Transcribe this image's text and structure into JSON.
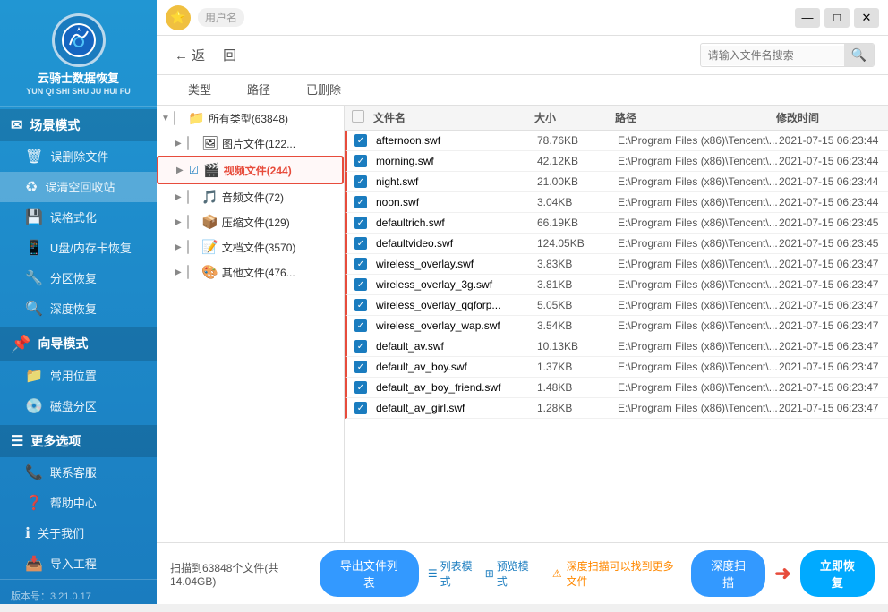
{
  "app": {
    "title": "云骑士数据恢复",
    "subtitle": "YUN QI SHI SHU JU HUI FU",
    "version": "版本号：3.21.0.17"
  },
  "sidebar": {
    "scene_mode_label": "场景模式",
    "items_scene": [
      {
        "id": "wrong-delete",
        "label": "误删除文件",
        "icon": "🗑"
      },
      {
        "id": "recycle-bin",
        "label": "误清空回收站",
        "icon": "♻",
        "active": true
      },
      {
        "id": "wrong-format",
        "label": "误格式化",
        "icon": "💾"
      },
      {
        "id": "usb-recover",
        "label": "U盘/内存卡恢复",
        "icon": "📱"
      },
      {
        "id": "partition",
        "label": "分区恢复",
        "icon": "🔧"
      },
      {
        "id": "deep-recover",
        "label": "深度恢复",
        "icon": "🔍"
      }
    ],
    "guide_mode_label": "向导模式",
    "items_guide": [
      {
        "id": "common-location",
        "label": "常用位置",
        "icon": "📁"
      },
      {
        "id": "disk-partition",
        "label": "磁盘分区",
        "icon": "💿"
      }
    ],
    "more_label": "更多选项",
    "items_more": [
      {
        "id": "contact",
        "label": "联系客服",
        "icon": "📞"
      },
      {
        "id": "help",
        "label": "帮助中心",
        "icon": "❓"
      },
      {
        "id": "about",
        "label": "关于我们",
        "icon": "ℹ"
      },
      {
        "id": "import",
        "label": "导入工程",
        "icon": "📥"
      }
    ]
  },
  "toolbar": {
    "back_label": "← 返",
    "forward_label": "回",
    "search_placeholder": "请输入文件名搜索"
  },
  "filter_tabs": [
    {
      "id": "type",
      "label": "类型",
      "active": false
    },
    {
      "id": "path",
      "label": "路径",
      "active": false
    },
    {
      "id": "deleted",
      "label": "已删除",
      "active": false
    }
  ],
  "file_header": {
    "check": "",
    "name": "文件名",
    "size": "大小",
    "path": "路径",
    "time": "修改时间"
  },
  "tree_items": [
    {
      "id": "all-types",
      "label": "所有类型(63848)",
      "icon": "📁",
      "level": 0,
      "expanded": true,
      "checked": false,
      "color": "#f0a030"
    },
    {
      "id": "image-files",
      "label": "图片文件(122...",
      "icon": "🖼",
      "level": 1,
      "expanded": false,
      "checked": false
    },
    {
      "id": "video-files",
      "label": "视频文件(244)",
      "icon": "🎬",
      "level": 1,
      "expanded": false,
      "checked": false,
      "highlighted": true
    },
    {
      "id": "audio-files",
      "label": "音频文件(72)",
      "icon": "🎵",
      "level": 1,
      "expanded": false,
      "checked": false
    },
    {
      "id": "compressed-files",
      "label": "压缩文件(129)",
      "icon": "📦",
      "level": 1,
      "expanded": false,
      "checked": false
    },
    {
      "id": "doc-files",
      "label": "文档文件(3570)",
      "icon": "📝",
      "level": 1,
      "expanded": false,
      "checked": false
    },
    {
      "id": "other-files",
      "label": "其他文件(476...",
      "icon": "🎨",
      "level": 1,
      "expanded": false,
      "checked": false
    }
  ],
  "files": [
    {
      "id": 1,
      "checked": true,
      "name": "afternoon.swf",
      "size": "78.76KB",
      "path": "E:\\Program Files (x86)\\Tencent\\...",
      "time": "2021-07-15 06:23:44",
      "highlighted": true
    },
    {
      "id": 2,
      "checked": true,
      "name": "morning.swf",
      "size": "42.12KB",
      "path": "E:\\Program Files (x86)\\Tencent\\...",
      "time": "2021-07-15 06:23:44",
      "highlighted": true
    },
    {
      "id": 3,
      "checked": true,
      "name": "night.swf",
      "size": "21.00KB",
      "path": "E:\\Program Files (x86)\\Tencent\\...",
      "time": "2021-07-15 06:23:44",
      "highlighted": true
    },
    {
      "id": 4,
      "checked": true,
      "name": "noon.swf",
      "size": "3.04KB",
      "path": "E:\\Program Files (x86)\\Tencent\\...",
      "time": "2021-07-15 06:23:44",
      "highlighted": true
    },
    {
      "id": 5,
      "checked": true,
      "name": "defaultrich.swf",
      "size": "66.19KB",
      "path": "E:\\Program Files (x86)\\Tencent\\...",
      "time": "2021-07-15 06:23:45",
      "highlighted": true
    },
    {
      "id": 6,
      "checked": true,
      "name": "defaultvideo.swf",
      "size": "124.05KB",
      "path": "E:\\Program Files (x86)\\Tencent\\...",
      "time": "2021-07-15 06:23:45",
      "highlighted": true
    },
    {
      "id": 7,
      "checked": true,
      "name": "wireless_overlay.swf",
      "size": "3.83KB",
      "path": "E:\\Program Files (x86)\\Tencent\\...",
      "time": "2021-07-15 06:23:47",
      "highlighted": true
    },
    {
      "id": 8,
      "checked": true,
      "name": "wireless_overlay_3g.swf",
      "size": "3.81KB",
      "path": "E:\\Program Files (x86)\\Tencent\\...",
      "time": "2021-07-15 06:23:47",
      "highlighted": true
    },
    {
      "id": 9,
      "checked": true,
      "name": "wireless_overlay_qqforp...",
      "size": "5.05KB",
      "path": "E:\\Program Files (x86)\\Tencent\\...",
      "time": "2021-07-15 06:23:47",
      "highlighted": true
    },
    {
      "id": 10,
      "checked": true,
      "name": "wireless_overlay_wap.swf",
      "size": "3.54KB",
      "path": "E:\\Program Files (x86)\\Tencent\\...",
      "time": "2021-07-15 06:23:47",
      "highlighted": true
    },
    {
      "id": 11,
      "checked": true,
      "name": "default_av.swf",
      "size": "10.13KB",
      "path": "E:\\Program Files (x86)\\Tencent\\...",
      "time": "2021-07-15 06:23:47",
      "highlighted": true
    },
    {
      "id": 12,
      "checked": true,
      "name": "default_av_boy.swf",
      "size": "1.37KB",
      "path": "E:\\Program Files (x86)\\Tencent\\...",
      "time": "2021-07-15 06:23:47",
      "highlighted": true
    },
    {
      "id": 13,
      "checked": true,
      "name": "default_av_boy_friend.swf",
      "size": "1.48KB",
      "path": "E:\\Program Files (x86)\\Tencent\\...",
      "time": "2021-07-15 06:23:47",
      "highlighted": true
    },
    {
      "id": 14,
      "checked": true,
      "name": "default_av_girl.swf",
      "size": "1.28KB",
      "path": "E:\\Program Files (x86)\\Tencent\\...",
      "time": "2021-07-15 06:23:47",
      "highlighted": true
    }
  ],
  "bottom": {
    "scan_info": "扫描到63848个文件(共14.04GB)",
    "export_btn": "导出文件列表",
    "deep_notice": "深度扫描可以找到更多文件",
    "deep_scan_btn": "深度扫描",
    "recover_btn": "立即恢复",
    "list_mode": "列表模式",
    "preview_mode": "预览模式"
  },
  "profile": {
    "name": "用户名",
    "icon": "⭐"
  },
  "window_controls": {
    "minimize": "—",
    "maximize": "□",
    "close": "✕"
  }
}
